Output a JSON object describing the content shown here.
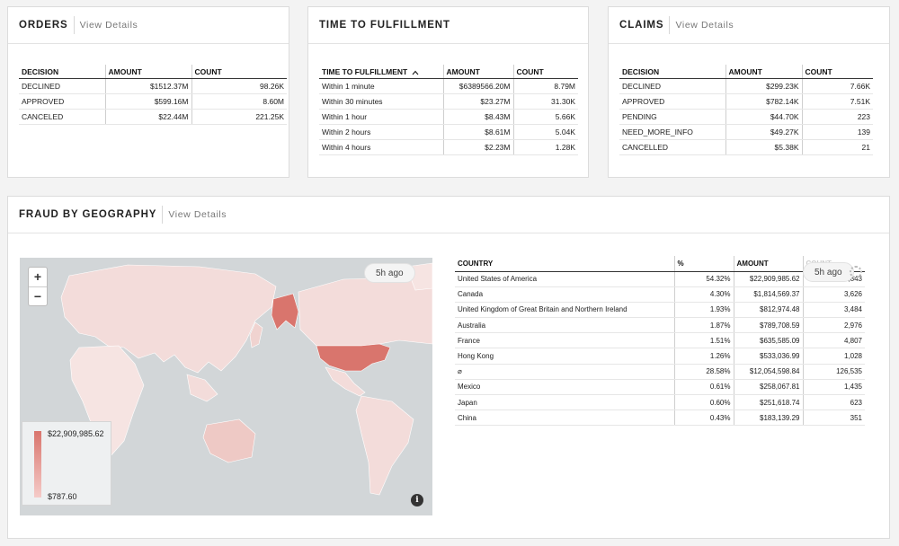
{
  "orders": {
    "title": "ORDERS",
    "view_details": "View Details",
    "columns": [
      "DECISION",
      "AMOUNT",
      "COUNT"
    ],
    "rows": [
      [
        "DECLINED",
        "$1512.37M",
        "98.26K"
      ],
      [
        "APPROVED",
        "$599.16M",
        "8.60M"
      ],
      [
        "CANCELED",
        "$22.44M",
        "221.25K"
      ]
    ]
  },
  "fulfillment": {
    "title": "TIME TO FULFILLMENT",
    "columns": [
      "TIME TO FULFILLMENT",
      "AMOUNT",
      "COUNT"
    ],
    "sort_icon": "chevron-up-icon",
    "rows": [
      [
        "Within 1 minute",
        "$6389566.20M",
        "8.79M"
      ],
      [
        "Within 30 minutes",
        "$23.27M",
        "31.30K"
      ],
      [
        "Within 1 hour",
        "$8.43M",
        "5.66K"
      ],
      [
        "Within 2 hours",
        "$8.61M",
        "5.04K"
      ],
      [
        "Within 4 hours",
        "$2.23M",
        "1.28K"
      ]
    ]
  },
  "claims": {
    "title": "CLAIMS",
    "view_details": "View Details",
    "columns": [
      "DECISION",
      "AMOUNT",
      "COUNT"
    ],
    "rows": [
      [
        "DECLINED",
        "$299.23K",
        "7.66K"
      ],
      [
        "APPROVED",
        "$782.14K",
        "7.51K"
      ],
      [
        "PENDING",
        "$44.70K",
        "223"
      ],
      [
        "NEED_MORE_INFO",
        "$49.27K",
        "139"
      ],
      [
        "CANCELLED",
        "$5.38K",
        "21"
      ]
    ]
  },
  "fraud": {
    "title": "FRAUD BY GEOGRAPHY",
    "view_details": "View Details",
    "map": {
      "zoom_in": "+",
      "zoom_out": "−",
      "timestamp": "5h ago",
      "legend_max": "$22,909,985.62",
      "legend_min": "$787.60",
      "info": "i",
      "land_color": "#f3dcda",
      "highlight_color": "#d9756d",
      "water_color": "#d2d6d8"
    },
    "table": {
      "columns": [
        "COUNTRY",
        "%",
        "AMOUNT",
        "COUNT"
      ],
      "timestamp": "5h ago",
      "rows": [
        [
          "United States of America",
          "54.32%",
          "$22,909,985.62",
          "59,843"
        ],
        [
          "Canada",
          "4.30%",
          "$1,814,569.37",
          "3,626"
        ],
        [
          "United Kingdom of Great Britain and Northern Ireland",
          "1.93%",
          "$812,974.48",
          "3,484"
        ],
        [
          "Australia",
          "1.87%",
          "$789,708.59",
          "2,976"
        ],
        [
          "France",
          "1.51%",
          "$635,585.09",
          "4,807"
        ],
        [
          "Hong Kong",
          "1.26%",
          "$533,036.99",
          "1,028"
        ],
        [
          "⌀",
          "28.58%",
          "$12,054,598.84",
          "126,535"
        ],
        [
          "Mexico",
          "0.61%",
          "$258,067.81",
          "1,435"
        ],
        [
          "Japan",
          "0.60%",
          "$251,618.74",
          "623"
        ],
        [
          "China",
          "0.43%",
          "$183,139.29",
          "351"
        ]
      ]
    }
  }
}
